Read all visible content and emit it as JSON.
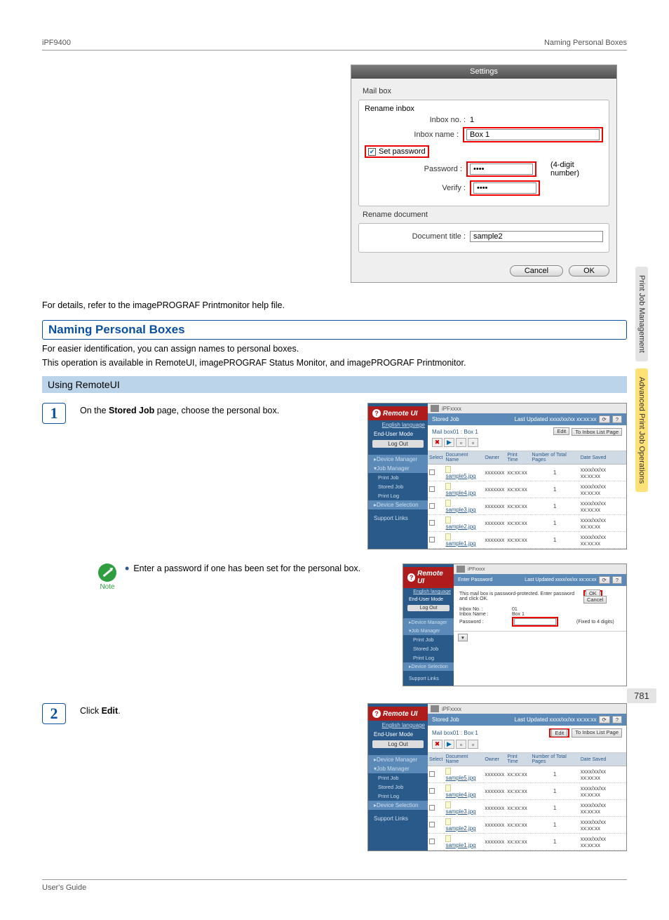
{
  "header": {
    "left": "iPF9400",
    "right": "Naming Personal Boxes"
  },
  "settings_dialog": {
    "title": "Settings",
    "mailbox_label": "Mail box",
    "rename_inbox_label": "Rename inbox",
    "inbox_no_label": "Inbox no. :",
    "inbox_no_value": "1",
    "inbox_name_label": "Inbox name :",
    "inbox_name_value": "Box 1",
    "set_password_label": "Set password",
    "password_label": "Password :",
    "password_value": "••••",
    "password_note": "(4-digit number)",
    "verify_label": "Verify :",
    "verify_value": "••••",
    "rename_document_label": "Rename document",
    "doc_title_label": "Document title :",
    "doc_title_value": "sample2",
    "cancel": "Cancel",
    "ok": "OK"
  },
  "body": {
    "details_line": "For details, refer to the imagePROGRAF Printmonitor help file.",
    "section_title": "Naming Personal Boxes",
    "para1": "For easier identification, you can assign names to personal boxes.",
    "para2": "This operation is available in RemoteUI, imagePROGRAF Status Monitor, and imagePROGRAF Printmonitor.",
    "sub_heading": "Using RemoteUI"
  },
  "step1": {
    "pre": "On the ",
    "bold": "Stored Job",
    "post": " page, choose the personal box."
  },
  "note": {
    "label": "Note",
    "bullet": "Enter a password if one has been set for the personal box."
  },
  "step2": {
    "pre": "Click ",
    "bold": "Edit",
    "post": "."
  },
  "remoteui": {
    "brand": "Remote UI",
    "device": "iPFxxxx",
    "lang": "English language",
    "mode": "End-User Mode",
    "logout": "Log Out",
    "nav": {
      "device_manager": "Device Manager",
      "job_manager": "Job Manager",
      "print_job": "Print Job",
      "stored_job": "Stored Job",
      "print_log": "Print Log",
      "device_selection": "Device Selection",
      "support_links": "Support Links"
    },
    "stored_job_title": "Stored Job",
    "last_updated": "Last Updated  xxxx/xx/xx xx:xx:xx",
    "mailbox": "Mail box01 : Box 1",
    "edit_btn": "Edit",
    "to_list_btn": "To Inbox List Page",
    "cols": {
      "select": "Select",
      "docname": "Document Name",
      "owner": "Owner",
      "print_time": "Print Time",
      "num_pages": "Number of Total Pages",
      "date_saved": "Date Saved"
    },
    "rows": [
      {
        "name": "sample5.jpg",
        "owner": "xxxxxxx",
        "time": "xx:xx:xx",
        "pages": "1",
        "date": "xxxx/xx/xx xx:xx:xx"
      },
      {
        "name": "sample4.jpg",
        "owner": "xxxxxxx",
        "time": "xx:xx:xx",
        "pages": "1",
        "date": "xxxx/xx/xx xx:xx:xx"
      },
      {
        "name": "sample3.jpg",
        "owner": "xxxxxxx",
        "time": "xx:xx:xx",
        "pages": "1",
        "date": "xxxx/xx/xx xx:xx:xx"
      },
      {
        "name": "sample2.jpg",
        "owner": "xxxxxxx",
        "time": "xx:xx:xx",
        "pages": "1",
        "date": "xxxx/xx/xx xx:xx:xx"
      },
      {
        "name": "sample1.jpg",
        "owner": "xxxxxxx",
        "time": "xx:xx:xx",
        "pages": "1",
        "date": "xxxx/xx/xx xx:xx:xx"
      }
    ],
    "enter_password": {
      "title": "Enter Password",
      "msg": "This mail box is password-protected. Enter password and click OK.",
      "inbox_no_l": "Inbox No. :",
      "inbox_no_v": "01",
      "inbox_name_l": "Inbox Name :",
      "inbox_name_v": "Box 1",
      "password_l": "Password :",
      "hint": "(Fixed to 4 digits)",
      "ok": "OK",
      "cancel": "Cancel"
    }
  },
  "side_tabs": {
    "t1": "Print Job Management",
    "t2": "Advanced Print Job Operations"
  },
  "page_number": "781",
  "footer": {
    "left": "User's Guide"
  }
}
